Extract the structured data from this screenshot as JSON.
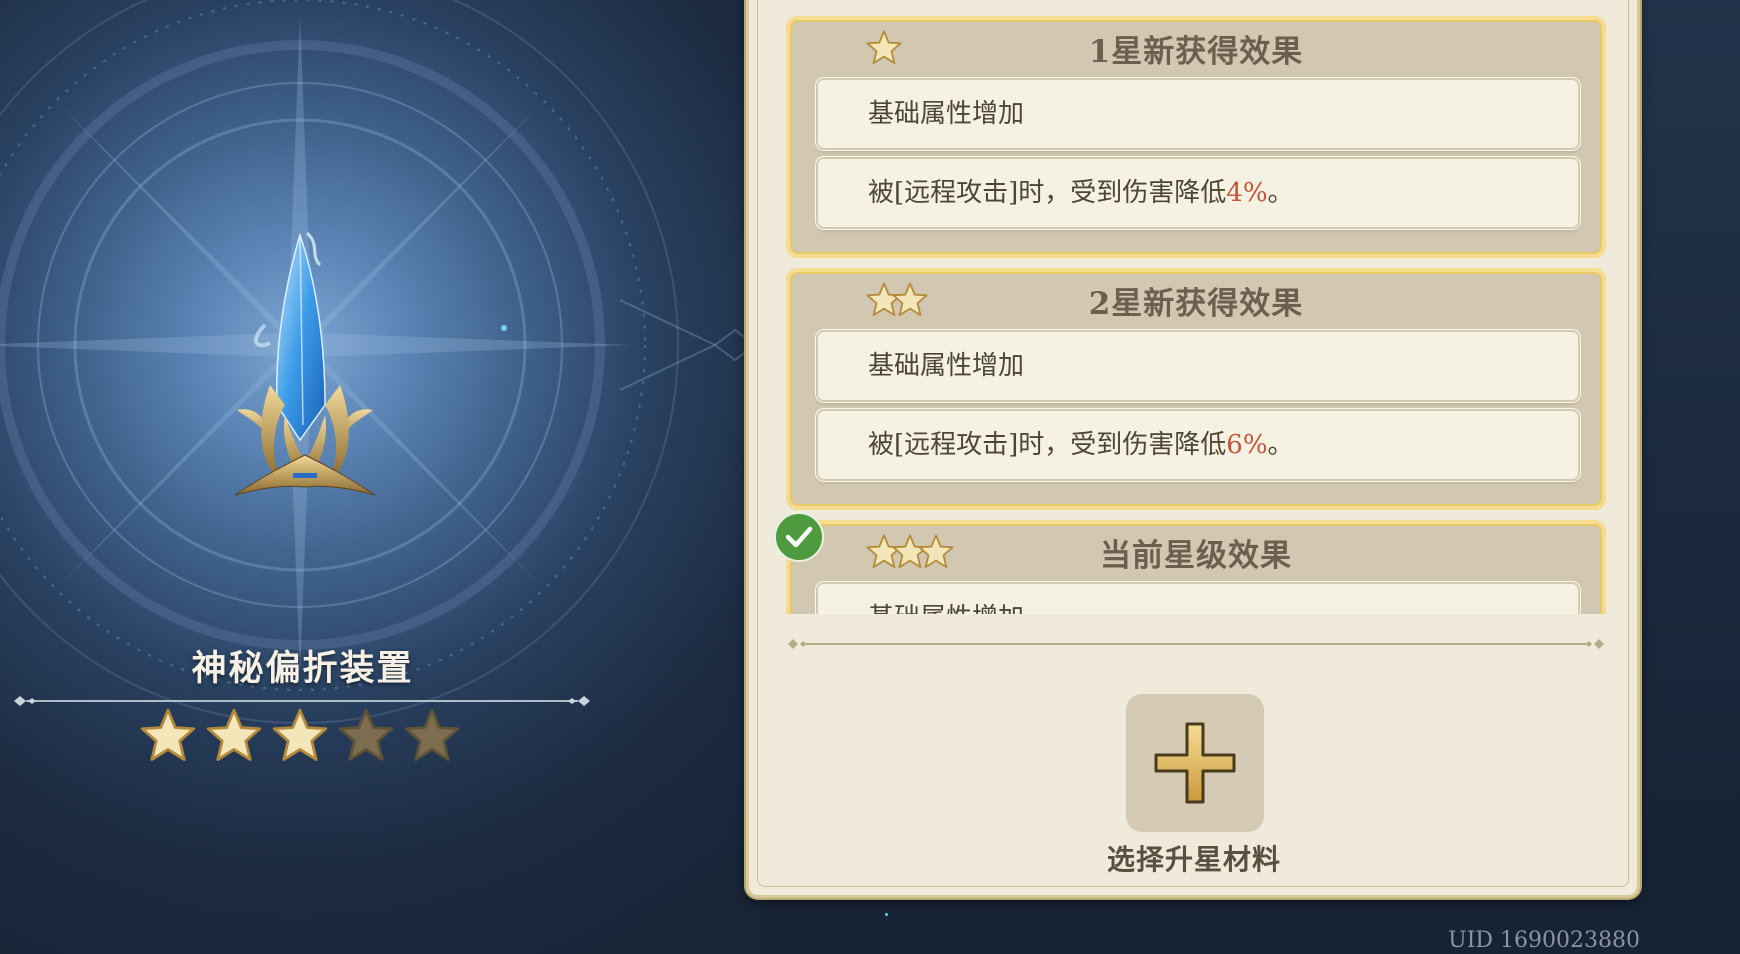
{
  "item": {
    "name": "神秘偏折装置",
    "star_level": 3,
    "max_stars": 5,
    "image_icon": "crystal-device-icon"
  },
  "effects": [
    {
      "stars": 1,
      "title": "1星新获得效果",
      "rows": [
        {
          "text": "基础属性增加"
        },
        {
          "prefix": "被[远程攻击]时，受到伤害降低",
          "value": "4%",
          "suffix": "。"
        }
      ]
    },
    {
      "stars": 2,
      "title": "2星新获得效果",
      "rows": [
        {
          "text": "基础属性增加"
        },
        {
          "prefix": "被[远程攻击]时，受到伤害降低",
          "value": "6%",
          "suffix": "。"
        }
      ]
    },
    {
      "stars": 3,
      "title": "当前星级效果",
      "current": true,
      "rows": [
        {
          "text": "基础属性增加"
        }
      ]
    }
  ],
  "upgrade": {
    "label": "选择升星材料",
    "icon": "plus-icon"
  },
  "uid": "UID 1690023880",
  "colors": {
    "highlight": "#c4533a",
    "star_filled": "#f3e6b8",
    "star_empty": "#7b6d4e",
    "check_green": "#4e9a3e"
  }
}
